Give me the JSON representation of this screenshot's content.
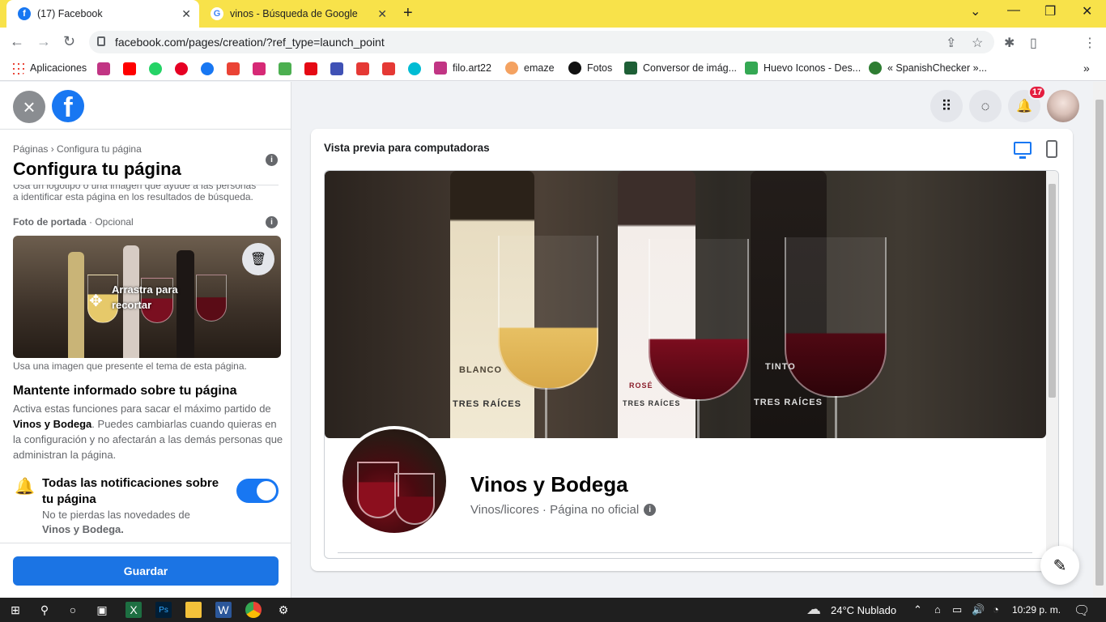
{
  "browser": {
    "tabs": [
      {
        "title": "(17) Facebook",
        "active": true
      },
      {
        "title": "vinos - Búsqueda de Google",
        "active": false
      }
    ],
    "url": "facebook.com/pages/creation/?ref_type=launch_point",
    "bookmarks": [
      "Aplicaciones",
      "filo.art22",
      "emaze",
      "Fotos",
      "Conversor de imág...",
      "Huevo Iconos - Des...",
      "« SpanishChecker »..."
    ]
  },
  "left": {
    "breadcrumb": "Páginas › Configura tu página",
    "title": "Configura tu página",
    "cut_note": "Usa un logotipo o una imagen que ayude a las personas a identificar esta página en los resultados de búsqueda.",
    "cover_label": "Foto de portada",
    "cover_optional": "· Opcional",
    "drag_text": "Arrastra para recortar",
    "cover_caption": "Usa una imagen que presente el tema de esta página.",
    "section_title": "Mantente informado sobre tu página",
    "section_desc_a": "Activa estas funciones para sacar el máximo partido de ",
    "section_desc_name": "Vinos y Bodega",
    "section_desc_b": ". Puedes cambiarlas cuando quieras en la configuración y no afectarán a las demás personas que administran la página.",
    "notif_title": "Todas las notificaciones sobre tu página",
    "notif_desc": "No te pierdas las novedades de",
    "notif_name": "Vinos y Bodega.",
    "save": "Guardar"
  },
  "header": {
    "badge": "17"
  },
  "preview": {
    "label": "Vista previa para computadoras",
    "page_name": "Vinos y Bodega",
    "page_sub": "Vinos/licores · Página no oficial",
    "bottle_labels": [
      "BLANCO",
      "TRES RAÍCES",
      "ROSÉ",
      "TRES RAÍCES",
      "TINTO",
      "TRES RAÍCES"
    ]
  },
  "taskbar": {
    "weather": "24°C  Nublado",
    "time": "10:29 p. m."
  }
}
